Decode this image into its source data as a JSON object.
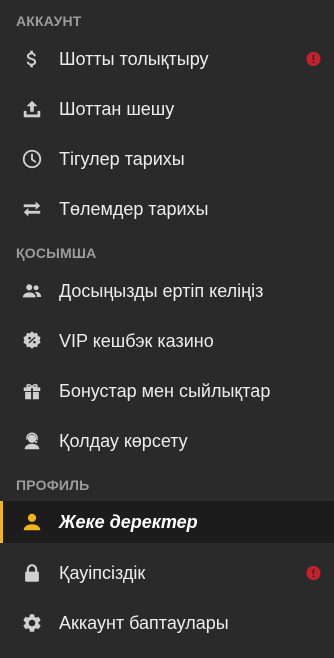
{
  "colors": {
    "background": "#2a2a2a",
    "active_background": "#1c1c1c",
    "accent": "#f2b31b",
    "alert": "#c8202a",
    "icon": "#d0d0d0",
    "section_text": "#9c9c9c"
  },
  "sections": [
    {
      "title": "АККАУНТ",
      "items": [
        {
          "label": "Шотты толықтыру",
          "icon": "dollar-icon",
          "alert": true
        },
        {
          "label": "Шоттан шешу",
          "icon": "upload-icon",
          "alert": false
        },
        {
          "label": "Тігулер тарихы",
          "icon": "clock-icon",
          "alert": false
        },
        {
          "label": "Төлемдер тарихы",
          "icon": "swap-arrows-icon",
          "alert": false
        }
      ]
    },
    {
      "title": "ҚОСЫМША",
      "items": [
        {
          "label": "Досыңызды ертіп келіңіз",
          "icon": "people-icon",
          "alert": false
        },
        {
          "label": "VIP кешбэк казино",
          "icon": "percent-badge-icon",
          "alert": false
        },
        {
          "label": "Бонустар мен сыйлықтар",
          "icon": "gift-icon",
          "alert": false
        },
        {
          "label": "Қолдау көрсету",
          "icon": "support-agent-icon",
          "alert": false
        }
      ]
    },
    {
      "title": "ПРОФИЛЬ",
      "items": [
        {
          "label": "Жеке деректер",
          "icon": "person-icon",
          "alert": false,
          "active": true
        },
        {
          "label": "Қауіпсіздік",
          "icon": "lock-icon",
          "alert": true
        },
        {
          "label": "Аккаунт баптаулары",
          "icon": "gear-icon",
          "alert": false
        }
      ]
    }
  ]
}
